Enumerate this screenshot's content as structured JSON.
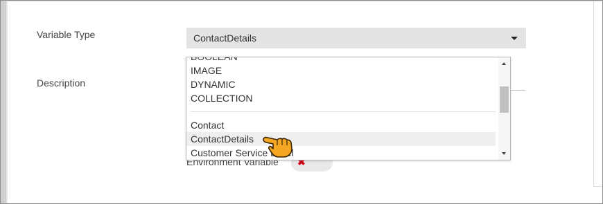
{
  "form": {
    "variable_type_label": "Variable Type",
    "description_label": "Description",
    "environment_variable_label": "Environment Variable",
    "selected_variable_type": "ContactDetails",
    "environment_variable_enabled": false
  },
  "dropdown": {
    "options_group1": [
      "BOOLEAN",
      "IMAGE",
      "DYNAMIC",
      "COLLECTION"
    ],
    "options_group2": [
      "Contact",
      "ContactDetails",
      "Customer Service Level"
    ],
    "highlighted": "ContactDetails"
  },
  "icons": {
    "select_arrow": "caret-down-icon",
    "toggle_off": "close-icon",
    "cursor": "hand-pointer-icon",
    "scroll_up": "arrow-up-icon",
    "scroll_down": "arrow-down-icon"
  },
  "colors": {
    "toggle_off_x": "#d0021b",
    "cursor_fill": "#f5a623",
    "select_bg": "#e4e4e4",
    "highlight_bg": "#efefef"
  }
}
